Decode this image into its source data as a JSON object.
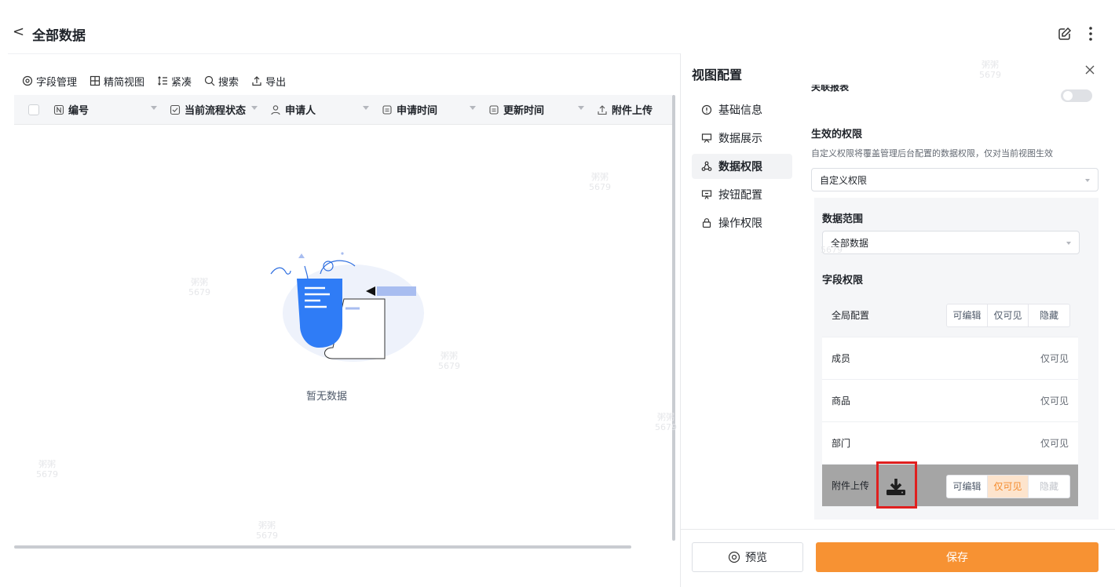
{
  "header": {
    "title": "全部数据",
    "back_glyph": "<",
    "edit_icon": "edit-icon",
    "more_icon": "more-icon"
  },
  "toolbar": {
    "fields": "字段管理",
    "simple_view": "精简视图",
    "compact": "紧凑",
    "search": "搜索",
    "export": "导出"
  },
  "table": {
    "columns": [
      "编号",
      "当前流程状态",
      "申请人",
      "申请时间",
      "更新时间",
      "附件上传"
    ],
    "empty_text": "暂无数据"
  },
  "watermark": {
    "line1": "粥粥",
    "line2": "5679"
  },
  "config": {
    "title": "视图配置",
    "nav": [
      "基础信息",
      "数据展示",
      "数据权限",
      "按钮配置",
      "操作权限"
    ],
    "active_nav": "数据权限",
    "cut_label": "关联报表",
    "effective_title": "生效的权限",
    "effective_hint": "自定义权限将覆盖管理后台配置的数据权限，仅对当前视图生效",
    "effective_value": "自定义权限",
    "scope_title": "数据范围",
    "scope_value": "全部数据",
    "field_perm_title": "字段权限",
    "global": {
      "label": "全局配置",
      "options": [
        "可编辑",
        "仅可见",
        "隐藏"
      ]
    },
    "rows": [
      {
        "label": "成员",
        "value": "仅可见"
      },
      {
        "label": "商品",
        "value": "仅可见"
      },
      {
        "label": "部门",
        "value": "仅可见"
      }
    ],
    "attach_row": {
      "label": "附件上传",
      "options": [
        "可编辑",
        "仅可见",
        "隐藏"
      ],
      "selected": "仅可见"
    },
    "preview_label": "预览",
    "save_label": "保存",
    "accent_color": "#f79233",
    "highlight_color": "#e0201f"
  }
}
